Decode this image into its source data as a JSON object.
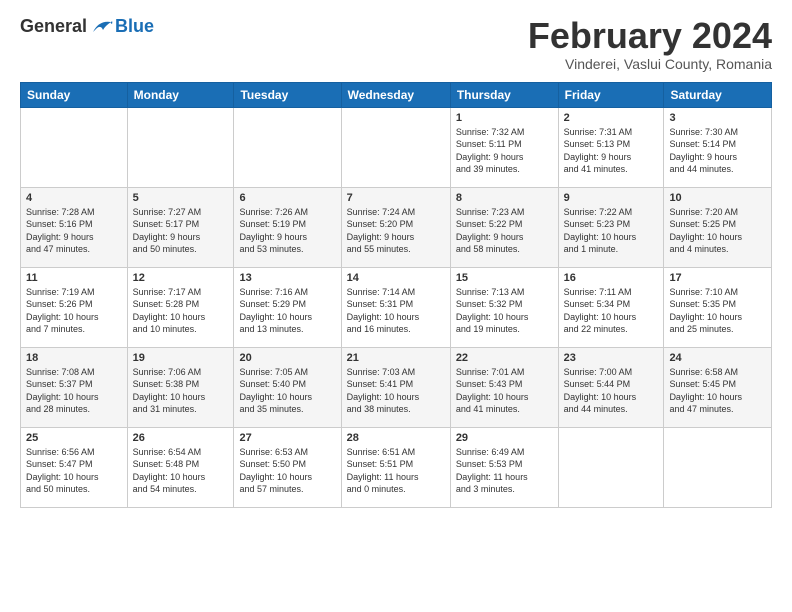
{
  "header": {
    "logo_general": "General",
    "logo_blue": "Blue",
    "month_title": "February 2024",
    "location": "Vinderei, Vaslui County, Romania"
  },
  "days_of_week": [
    "Sunday",
    "Monday",
    "Tuesday",
    "Wednesday",
    "Thursday",
    "Friday",
    "Saturday"
  ],
  "weeks": [
    {
      "days": [
        {
          "num": "",
          "info": ""
        },
        {
          "num": "",
          "info": ""
        },
        {
          "num": "",
          "info": ""
        },
        {
          "num": "",
          "info": ""
        },
        {
          "num": "1",
          "info": "Sunrise: 7:32 AM\nSunset: 5:11 PM\nDaylight: 9 hours\nand 39 minutes."
        },
        {
          "num": "2",
          "info": "Sunrise: 7:31 AM\nSunset: 5:13 PM\nDaylight: 9 hours\nand 41 minutes."
        },
        {
          "num": "3",
          "info": "Sunrise: 7:30 AM\nSunset: 5:14 PM\nDaylight: 9 hours\nand 44 minutes."
        }
      ]
    },
    {
      "days": [
        {
          "num": "4",
          "info": "Sunrise: 7:28 AM\nSunset: 5:16 PM\nDaylight: 9 hours\nand 47 minutes."
        },
        {
          "num": "5",
          "info": "Sunrise: 7:27 AM\nSunset: 5:17 PM\nDaylight: 9 hours\nand 50 minutes."
        },
        {
          "num": "6",
          "info": "Sunrise: 7:26 AM\nSunset: 5:19 PM\nDaylight: 9 hours\nand 53 minutes."
        },
        {
          "num": "7",
          "info": "Sunrise: 7:24 AM\nSunset: 5:20 PM\nDaylight: 9 hours\nand 55 minutes."
        },
        {
          "num": "8",
          "info": "Sunrise: 7:23 AM\nSunset: 5:22 PM\nDaylight: 9 hours\nand 58 minutes."
        },
        {
          "num": "9",
          "info": "Sunrise: 7:22 AM\nSunset: 5:23 PM\nDaylight: 10 hours\nand 1 minute."
        },
        {
          "num": "10",
          "info": "Sunrise: 7:20 AM\nSunset: 5:25 PM\nDaylight: 10 hours\nand 4 minutes."
        }
      ]
    },
    {
      "days": [
        {
          "num": "11",
          "info": "Sunrise: 7:19 AM\nSunset: 5:26 PM\nDaylight: 10 hours\nand 7 minutes."
        },
        {
          "num": "12",
          "info": "Sunrise: 7:17 AM\nSunset: 5:28 PM\nDaylight: 10 hours\nand 10 minutes."
        },
        {
          "num": "13",
          "info": "Sunrise: 7:16 AM\nSunset: 5:29 PM\nDaylight: 10 hours\nand 13 minutes."
        },
        {
          "num": "14",
          "info": "Sunrise: 7:14 AM\nSunset: 5:31 PM\nDaylight: 10 hours\nand 16 minutes."
        },
        {
          "num": "15",
          "info": "Sunrise: 7:13 AM\nSunset: 5:32 PM\nDaylight: 10 hours\nand 19 minutes."
        },
        {
          "num": "16",
          "info": "Sunrise: 7:11 AM\nSunset: 5:34 PM\nDaylight: 10 hours\nand 22 minutes."
        },
        {
          "num": "17",
          "info": "Sunrise: 7:10 AM\nSunset: 5:35 PM\nDaylight: 10 hours\nand 25 minutes."
        }
      ]
    },
    {
      "days": [
        {
          "num": "18",
          "info": "Sunrise: 7:08 AM\nSunset: 5:37 PM\nDaylight: 10 hours\nand 28 minutes."
        },
        {
          "num": "19",
          "info": "Sunrise: 7:06 AM\nSunset: 5:38 PM\nDaylight: 10 hours\nand 31 minutes."
        },
        {
          "num": "20",
          "info": "Sunrise: 7:05 AM\nSunset: 5:40 PM\nDaylight: 10 hours\nand 35 minutes."
        },
        {
          "num": "21",
          "info": "Sunrise: 7:03 AM\nSunset: 5:41 PM\nDaylight: 10 hours\nand 38 minutes."
        },
        {
          "num": "22",
          "info": "Sunrise: 7:01 AM\nSunset: 5:43 PM\nDaylight: 10 hours\nand 41 minutes."
        },
        {
          "num": "23",
          "info": "Sunrise: 7:00 AM\nSunset: 5:44 PM\nDaylight: 10 hours\nand 44 minutes."
        },
        {
          "num": "24",
          "info": "Sunrise: 6:58 AM\nSunset: 5:45 PM\nDaylight: 10 hours\nand 47 minutes."
        }
      ]
    },
    {
      "days": [
        {
          "num": "25",
          "info": "Sunrise: 6:56 AM\nSunset: 5:47 PM\nDaylight: 10 hours\nand 50 minutes."
        },
        {
          "num": "26",
          "info": "Sunrise: 6:54 AM\nSunset: 5:48 PM\nDaylight: 10 hours\nand 54 minutes."
        },
        {
          "num": "27",
          "info": "Sunrise: 6:53 AM\nSunset: 5:50 PM\nDaylight: 10 hours\nand 57 minutes."
        },
        {
          "num": "28",
          "info": "Sunrise: 6:51 AM\nSunset: 5:51 PM\nDaylight: 11 hours\nand 0 minutes."
        },
        {
          "num": "29",
          "info": "Sunrise: 6:49 AM\nSunset: 5:53 PM\nDaylight: 11 hours\nand 3 minutes."
        },
        {
          "num": "",
          "info": ""
        },
        {
          "num": "",
          "info": ""
        }
      ]
    }
  ]
}
